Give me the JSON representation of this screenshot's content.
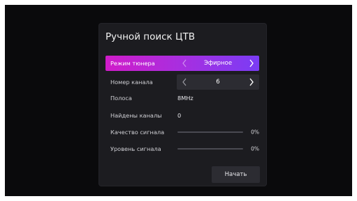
{
  "dialog": {
    "title": "Ручной поиск ЦТВ"
  },
  "rows": {
    "tuner_mode": {
      "label": "Режим тюнера",
      "value": "Эфирное"
    },
    "channel_number": {
      "label": "Номер канала",
      "value": "6"
    },
    "band": {
      "label": "Полоса",
      "value": "8MHz"
    },
    "found_channels": {
      "label": "Найдены каналы",
      "value": "0"
    },
    "signal_quality": {
      "label": "Качество сигнала",
      "percent": "0%",
      "level": 0
    },
    "signal_level": {
      "label": "Уровень сигнала",
      "percent": "0%",
      "level": 0
    }
  },
  "buttons": {
    "start_label": "Начать"
  },
  "icons": {
    "left_arrow": "chevron-left-icon",
    "right_arrow": "chevron-right-icon"
  },
  "colors": {
    "highlight_start": "#d01cc9",
    "highlight_end": "#7a3cf5",
    "background": "#0a0a0c",
    "dialog": "#1c1c20"
  }
}
